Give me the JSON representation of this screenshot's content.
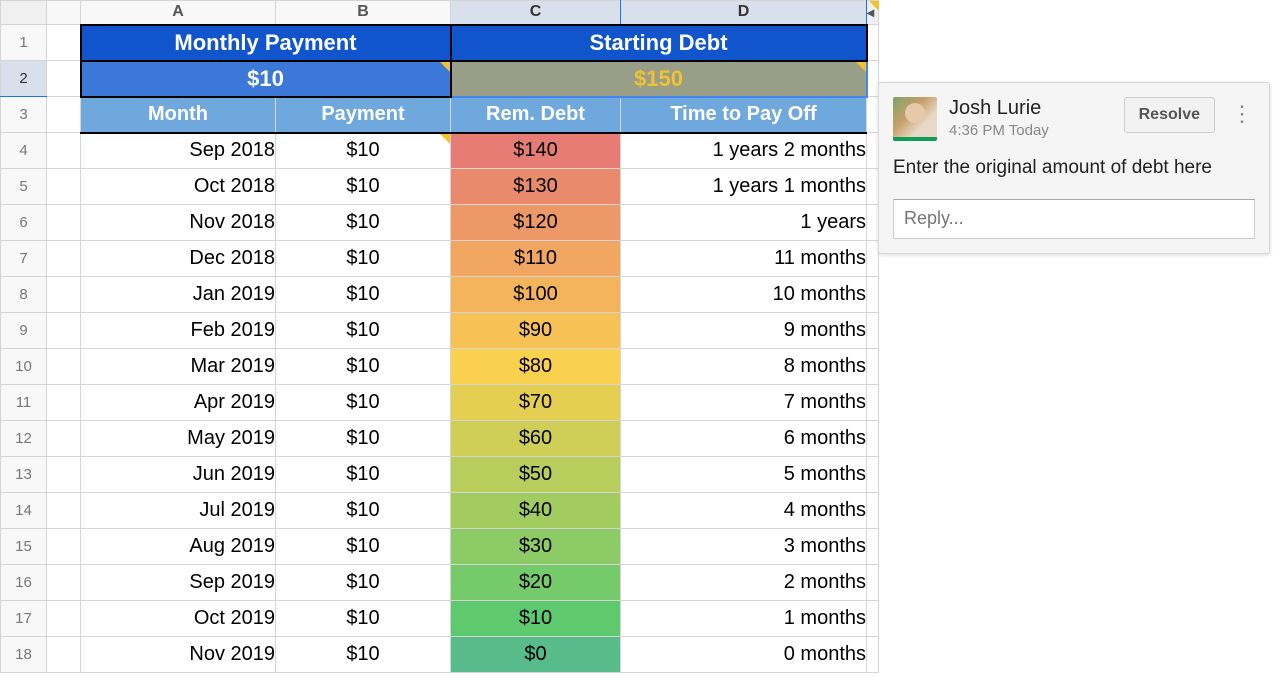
{
  "columns": {
    "A": "A",
    "B": "B",
    "C": "C",
    "D": "D"
  },
  "header1": {
    "monthly_payment_label": "Monthly Payment",
    "starting_debt_label": "Starting Debt"
  },
  "header2": {
    "monthly_payment_value": "$10",
    "starting_debt_value": "$150"
  },
  "subheader": {
    "month": "Month",
    "payment": "Payment",
    "rem_debt": "Rem. Debt",
    "time_to_pay": "Time to Pay Off"
  },
  "row_numbers": [
    "1",
    "2",
    "3",
    "4",
    "5",
    "6",
    "7",
    "8",
    "9",
    "10",
    "11",
    "12",
    "13",
    "14",
    "15",
    "16",
    "17",
    "18"
  ],
  "debt_colors": [
    "#e67c73",
    "#ea8a6d",
    "#ed9867",
    "#f1a661",
    "#f4b45b",
    "#f7c255",
    "#fad04f",
    "#e5cf53",
    "#cfce57",
    "#b8cd5b",
    "#a2cc60",
    "#8ccb65",
    "#75ca6a",
    "#5fc96f",
    "#57bb8a"
  ],
  "rows": [
    {
      "month": "Sep 2018",
      "payment": "$10",
      "rem": "$140",
      "time": "1 years 2 months"
    },
    {
      "month": "Oct 2018",
      "payment": "$10",
      "rem": "$130",
      "time": "1 years 1 months"
    },
    {
      "month": "Nov 2018",
      "payment": "$10",
      "rem": "$120",
      "time": "1 years"
    },
    {
      "month": "Dec 2018",
      "payment": "$10",
      "rem": "$110",
      "time": "11 months"
    },
    {
      "month": "Jan 2019",
      "payment": "$10",
      "rem": "$100",
      "time": "10 months"
    },
    {
      "month": "Feb 2019",
      "payment": "$10",
      "rem": "$90",
      "time": "9 months"
    },
    {
      "month": "Mar 2019",
      "payment": "$10",
      "rem": "$80",
      "time": "8 months"
    },
    {
      "month": "Apr 2019",
      "payment": "$10",
      "rem": "$70",
      "time": "7 months"
    },
    {
      "month": "May 2019",
      "payment": "$10",
      "rem": "$60",
      "time": "6 months"
    },
    {
      "month": "Jun 2019",
      "payment": "$10",
      "rem": "$50",
      "time": "5 months"
    },
    {
      "month": "Jul 2019",
      "payment": "$10",
      "rem": "$40",
      "time": "4 months"
    },
    {
      "month": "Aug 2019",
      "payment": "$10",
      "rem": "$30",
      "time": "3 months"
    },
    {
      "month": "Sep 2019",
      "payment": "$10",
      "rem": "$20",
      "time": "2 months"
    },
    {
      "month": "Oct 2019",
      "payment": "$10",
      "rem": "$10",
      "time": "1 months"
    },
    {
      "month": "Nov 2019",
      "payment": "$10",
      "rem": "$0",
      "time": "0 months"
    }
  ],
  "comment": {
    "author": "Josh Lurie",
    "timestamp": "4:36 PM Today",
    "body": "Enter the original amount of debt here",
    "resolve_label": "Resolve",
    "reply_placeholder": "Reply..."
  }
}
